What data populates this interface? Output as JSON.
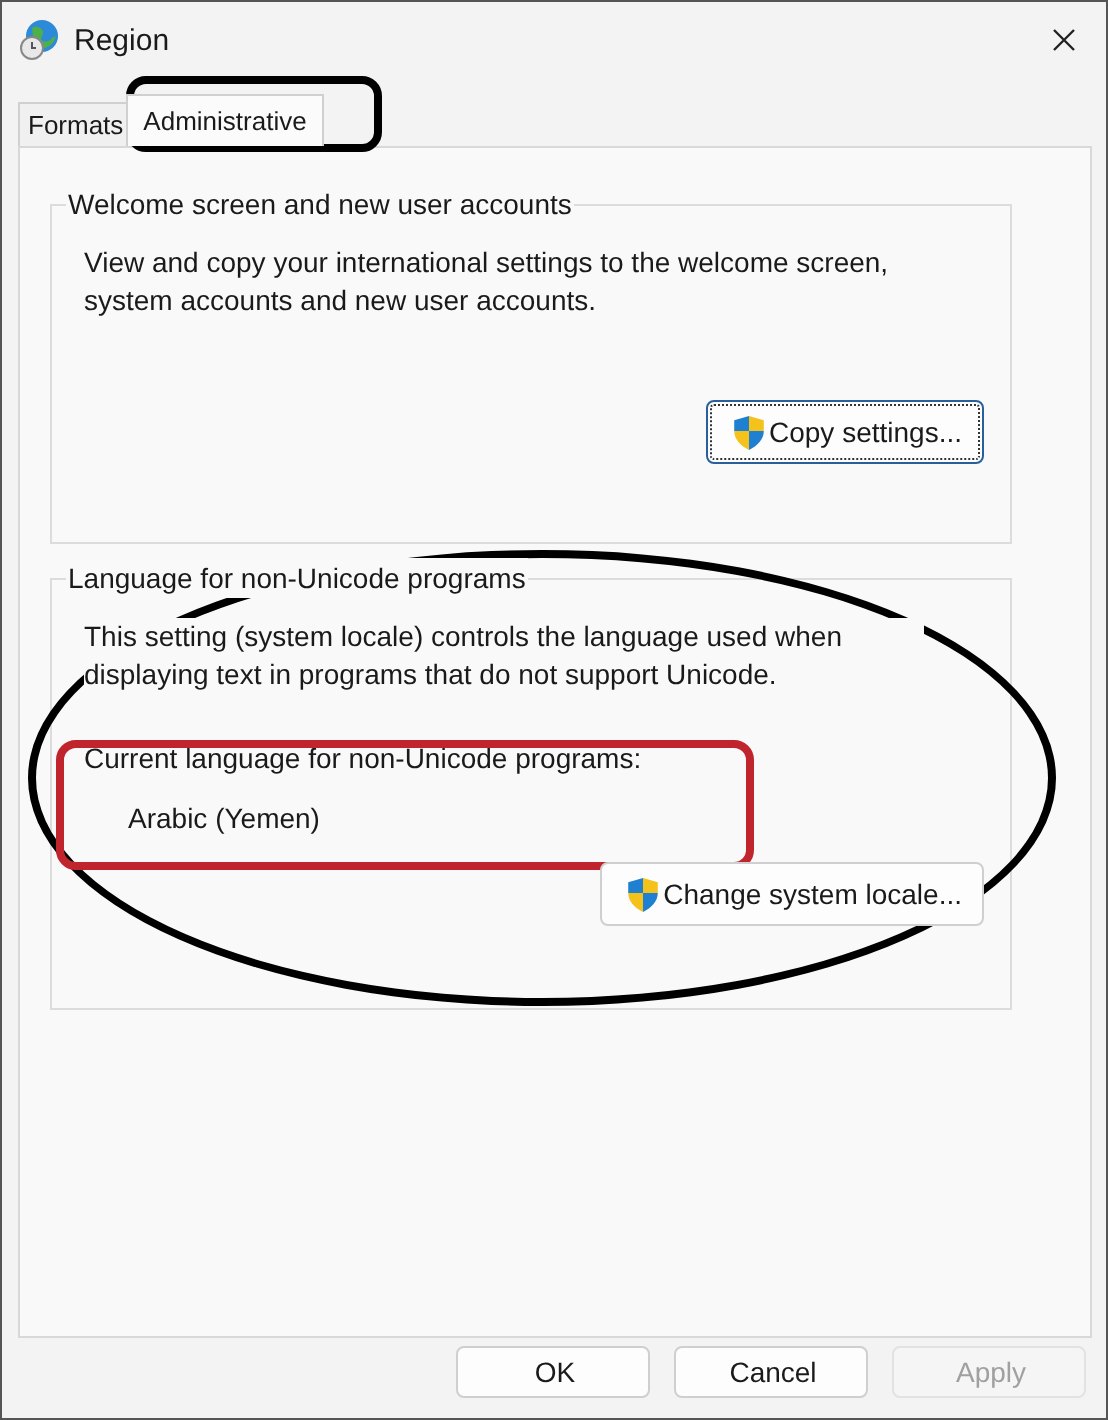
{
  "window": {
    "title": "Region"
  },
  "tabs": [
    {
      "label": "Formats",
      "selected": false
    },
    {
      "label": "Administrative",
      "selected": true
    }
  ],
  "groups": [
    {
      "title": "Welcome screen and new user accounts",
      "text": "View and copy your international settings to the welcome screen, system accounts and new user accounts.",
      "button": "Copy settings..."
    },
    {
      "title": "Language for non-Unicode programs",
      "text": "This setting (system locale) controls the language used when displaying text in programs that do not support Unicode.",
      "label": "Current language for non-Unicode programs:",
      "value": "Arabic (Yemen)",
      "button": "Change system locale..."
    }
  ],
  "buttons": [
    {
      "label": "OK",
      "disabled": false
    },
    {
      "label": "Cancel",
      "disabled": false
    },
    {
      "label": "Apply",
      "disabled": true
    }
  ],
  "annotations": [
    {
      "kind": "rect",
      "color": "#000000"
    },
    {
      "kind": "ellipse",
      "color": "#000000"
    },
    {
      "kind": "rect",
      "color": "#c0242c"
    }
  ]
}
